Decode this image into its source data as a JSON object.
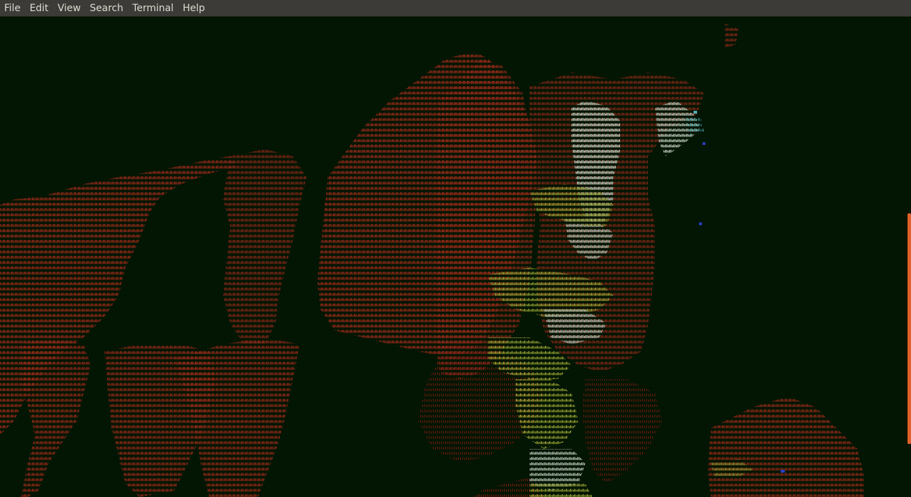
{
  "menubar": {
    "items": [
      "File",
      "Edit",
      "View",
      "Search",
      "Terminal",
      "Help"
    ]
  },
  "terminal": {
    "content_description_icon": "ascii-art-dragon",
    "background_color": "#031503",
    "palette": {
      "red": "#a82a1c",
      "dark_red": "#7a1d12",
      "yellow_green": "#b5c23a",
      "white": "#c8d6c8",
      "teal": "#4fb0b8",
      "blue": "#2a3fbf"
    }
  },
  "scrollbar": {
    "accent": "#e0622a"
  }
}
